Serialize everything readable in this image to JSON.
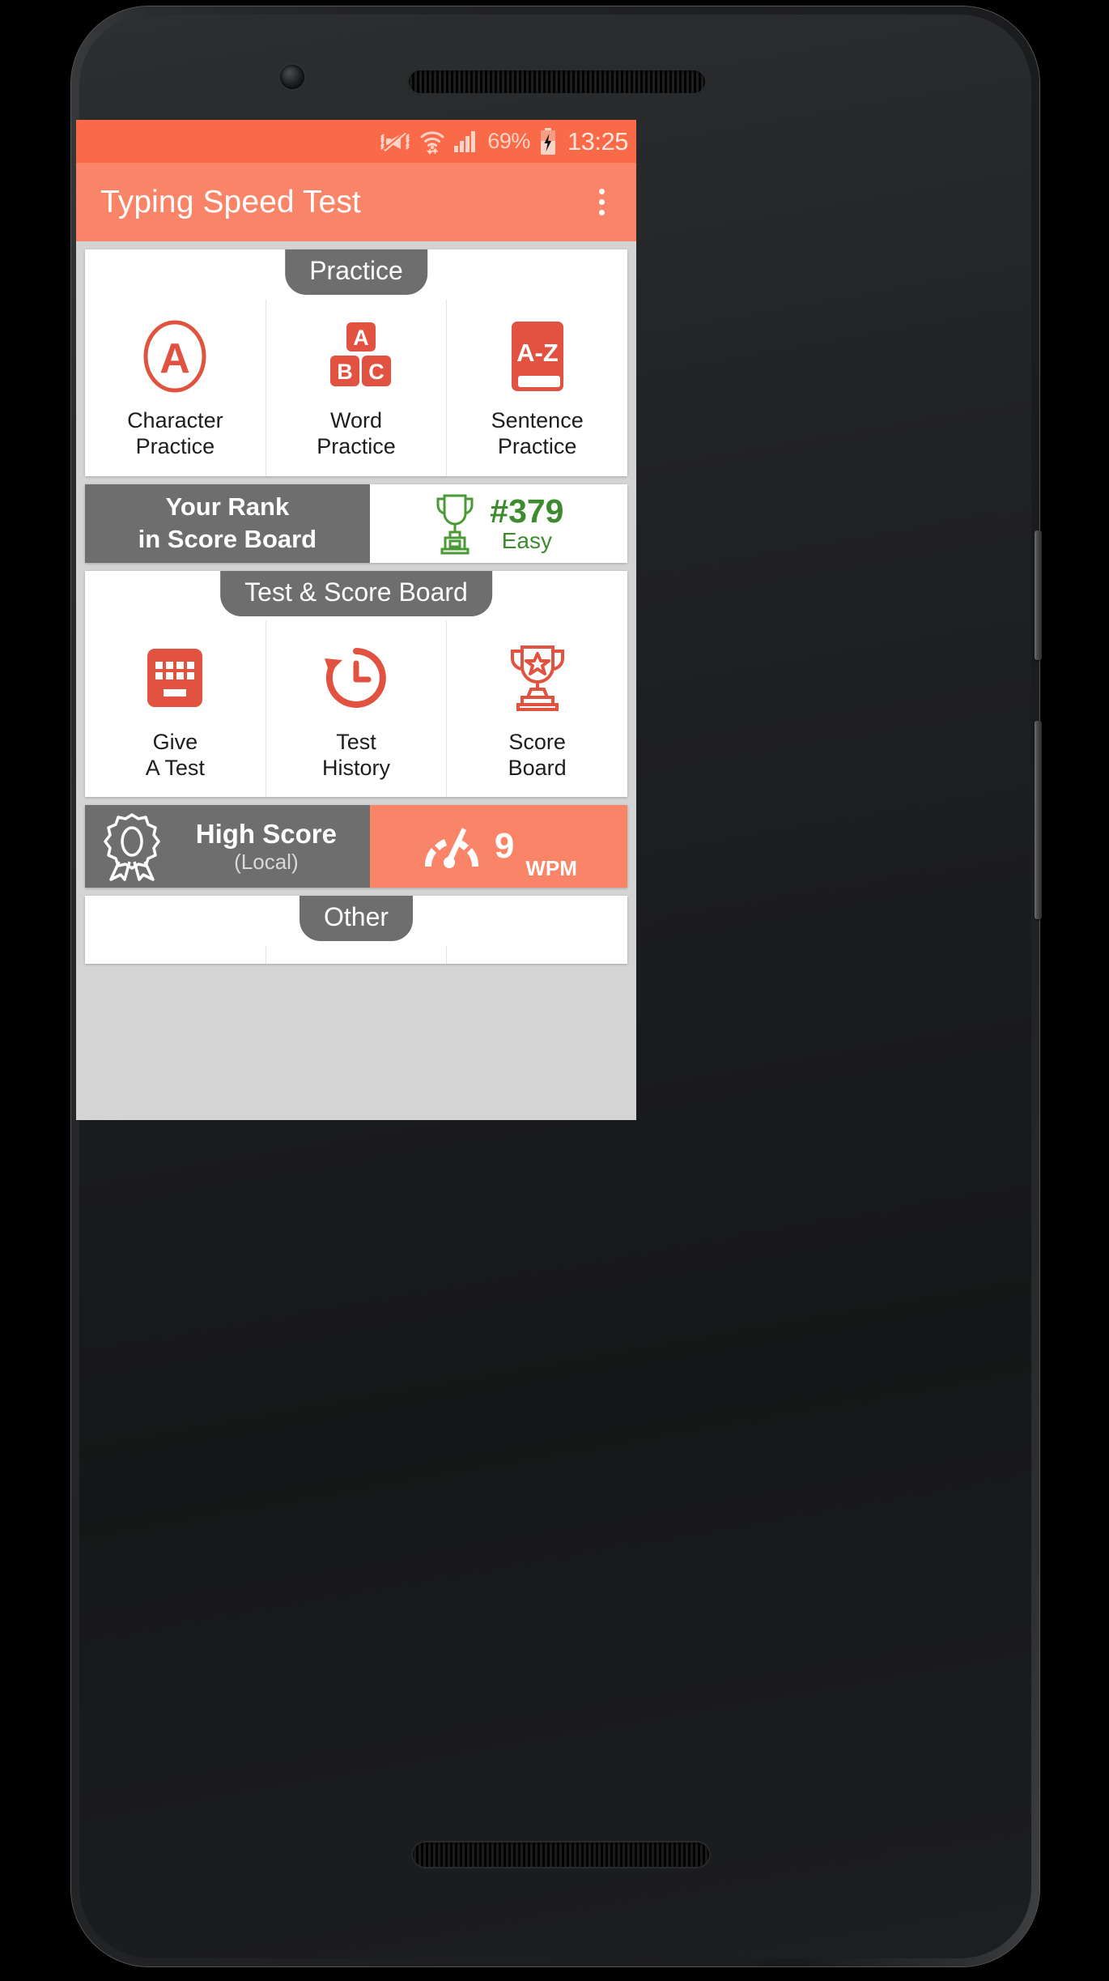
{
  "status_bar": {
    "vibrate_icon": "vibrate-off-icon",
    "wifi_icon": "wifi-data-transfer-icon",
    "signal_icon": "cellular-signal-icon",
    "battery_percent": "69%",
    "battery_icon": "battery-charging-icon",
    "time": "13:25",
    "background_color": "#fb6a48"
  },
  "app_bar": {
    "title": "Typing Speed Test",
    "overflow_icon": "overflow-menu-icon",
    "background_color": "#fa8468"
  },
  "practice_card": {
    "header": "Practice",
    "items": [
      {
        "label": "Character\nPractice",
        "icon": "circled-letter-a-icon"
      },
      {
        "label": "Word\nPractice",
        "icon": "abc-blocks-icon"
      },
      {
        "label": "Sentence\nPractice",
        "icon": "a-to-z-book-icon"
      }
    ]
  },
  "rank_strip": {
    "label_line1": "Your Rank",
    "label_line2": "in Score Board",
    "trophy_icon": "trophy-outline-icon",
    "rank": "#379",
    "difficulty": "Easy",
    "rank_color": "#3d8b2e",
    "label_background": "#6e6e6e"
  },
  "test_card": {
    "header": "Test & Score Board",
    "items": [
      {
        "label": "Give\nA Test",
        "icon": "keyboard-icon"
      },
      {
        "label": "Test\nHistory",
        "icon": "clock-history-icon"
      },
      {
        "label": "Score\nBoard",
        "icon": "trophy-star-icon"
      }
    ]
  },
  "highscore_strip": {
    "ribbon_icon": "award-ribbon-icon",
    "title": "High Score",
    "scope": "(Local)",
    "speedometer_icon": "speedometer-icon",
    "value": "9",
    "unit": "WPM",
    "label_background": "#6e6e6e",
    "value_background": "#fa8468"
  },
  "other_card": {
    "header": "Other"
  },
  "theme": {
    "accent": "#fa8468",
    "icon_red": "#e15241",
    "gray_tab": "#6e6e6e",
    "page_background": "#d4d4d4"
  }
}
